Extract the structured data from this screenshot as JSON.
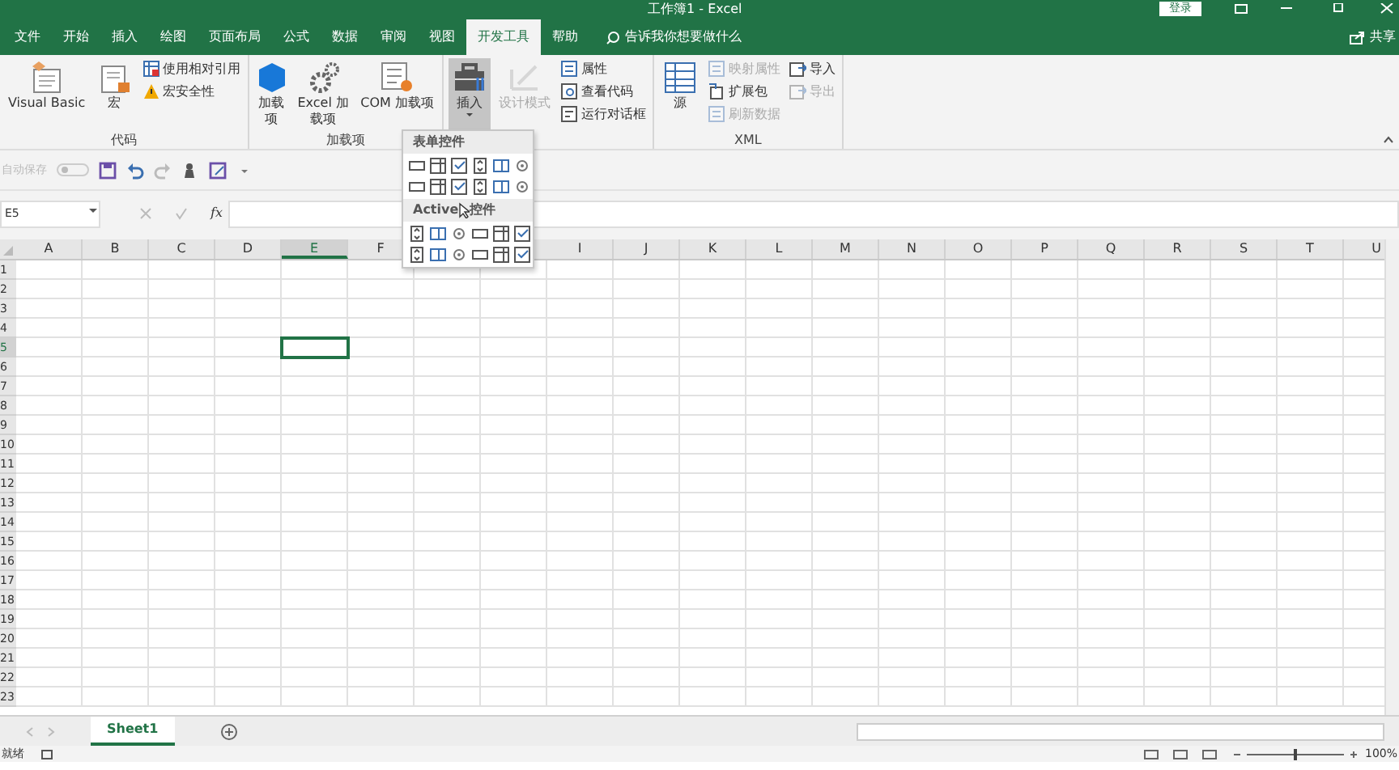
{
  "window": {
    "title": "工作簿1 - Excel",
    "sign_in": "登录"
  },
  "tabs": [
    {
      "label": "文件",
      "selected": false
    },
    {
      "label": "开始",
      "selected": false
    },
    {
      "label": "插入",
      "selected": false
    },
    {
      "label": "绘图",
      "selected": false
    },
    {
      "label": "页面布局",
      "selected": false
    },
    {
      "label": "公式",
      "selected": false
    },
    {
      "label": "数据",
      "selected": false
    },
    {
      "label": "审阅",
      "selected": false
    },
    {
      "label": "视图",
      "selected": false
    },
    {
      "label": "开发工具",
      "selected": true
    },
    {
      "label": "帮助",
      "selected": false
    }
  ],
  "tell_me": {
    "placeholder": "告诉我你想要做什么"
  },
  "share": "共享",
  "ribbon_groups": [
    {
      "label": "代码",
      "items": [
        {
          "kind": "large",
          "label": "Visual Basic",
          "disabled": false,
          "selected": false
        },
        {
          "kind": "large",
          "label": "宏",
          "disabled": false,
          "selected": false
        },
        {
          "kind": "small",
          "label": "使用相对引用",
          "disabled": false,
          "selected": false
        },
        {
          "kind": "small",
          "label": "宏安全性",
          "disabled": false,
          "selected": false
        }
      ]
    },
    {
      "label": "加载项",
      "items": [
        {
          "kind": "large",
          "label": "加载项",
          "disabled": false,
          "selected": false
        },
        {
          "kind": "large",
          "label": "Excel 加载项",
          "disabled": false,
          "selected": false
        },
        {
          "kind": "large",
          "label": "COM 加载项",
          "disabled": false,
          "selected": false
        }
      ]
    },
    {
      "items": [
        {
          "kind": "large",
          "label": "插入",
          "disabled": false,
          "selected": true
        },
        {
          "kind": "large",
          "label": "设计模式",
          "disabled": true,
          "selected": false
        },
        {
          "kind": "small",
          "label": "属性",
          "disabled": false,
          "selected": false
        },
        {
          "kind": "small",
          "label": "查看代码",
          "disabled": false,
          "selected": false
        },
        {
          "kind": "small",
          "label": "运行对话框",
          "disabled": false,
          "selected": false
        }
      ]
    },
    {
      "label": "XML",
      "items": [
        {
          "kind": "large",
          "label": "源",
          "disabled": false,
          "selected": false
        },
        {
          "kind": "small",
          "label": "映射属性",
          "disabled": true,
          "selected": false
        },
        {
          "kind": "small",
          "label": "扩展包",
          "disabled": false,
          "selected": false
        },
        {
          "kind": "small",
          "label": "刷新数据",
          "disabled": true,
          "selected": false
        },
        {
          "kind": "small",
          "label": "导入",
          "disabled": false,
          "selected": false
        },
        {
          "kind": "small",
          "label": "导出",
          "disabled": true,
          "selected": false
        }
      ]
    }
  ],
  "insert_menu": {
    "sections": [
      {
        "title_parts": [
          "表单控件"
        ]
      },
      {
        "title_parts": [
          "Active",
          "控件"
        ]
      }
    ]
  },
  "quick_access": {
    "autosave_label": "自动保存",
    "autosave_on": false
  },
  "formula_bar": {
    "name_box": "E5",
    "function_label": "fx"
  },
  "columns": [
    {
      "label": "A",
      "selected": false
    },
    {
      "label": "B",
      "selected": false
    },
    {
      "label": "C",
      "selected": false
    },
    {
      "label": "D",
      "selected": false
    },
    {
      "label": "E",
      "selected": true
    },
    {
      "label": "F",
      "selected": false
    },
    {
      "label": "I",
      "selected": false
    },
    {
      "label": "J",
      "selected": false
    },
    {
      "label": "K",
      "selected": false
    },
    {
      "label": "L",
      "selected": false
    },
    {
      "label": "M",
      "selected": false
    },
    {
      "label": "N",
      "selected": false
    },
    {
      "label": "O",
      "selected": false
    },
    {
      "label": "P",
      "selected": false
    },
    {
      "label": "Q",
      "selected": false
    },
    {
      "label": "R",
      "selected": false
    },
    {
      "label": "S",
      "selected": false
    },
    {
      "label": "T",
      "selected": false
    },
    {
      "label": "U",
      "selected": false
    }
  ],
  "rows": [
    {
      "label": "1",
      "selected": false
    },
    {
      "label": "2",
      "selected": false
    },
    {
      "label": "3",
      "selected": false
    },
    {
      "label": "4",
      "selected": false
    },
    {
      "label": "5",
      "selected": true
    },
    {
      "label": "6",
      "selected": false
    },
    {
      "label": "7",
      "selected": false
    },
    {
      "label": "8",
      "selected": false
    },
    {
      "label": "9",
      "selected": false
    },
    {
      "label": "10",
      "selected": false
    },
    {
      "label": "11",
      "selected": false
    },
    {
      "label": "12",
      "selected": false
    },
    {
      "label": "13",
      "selected": false
    },
    {
      "label": "14",
      "selected": false
    },
    {
      "label": "15",
      "selected": false
    },
    {
      "label": "16",
      "selected": false
    },
    {
      "label": "17",
      "selected": false
    },
    {
      "label": "18",
      "selected": false
    },
    {
      "label": "19",
      "selected": false
    },
    {
      "label": "20",
      "selected": false
    },
    {
      "label": "21",
      "selected": false
    },
    {
      "label": "22",
      "selected": false
    },
    {
      "label": "23",
      "selected": false
    }
  ],
  "sheet_tabs": [
    {
      "label": "Sheet1",
      "selected": true
    }
  ],
  "status_bar": {
    "ready": "就绪",
    "zoom": "100%"
  }
}
